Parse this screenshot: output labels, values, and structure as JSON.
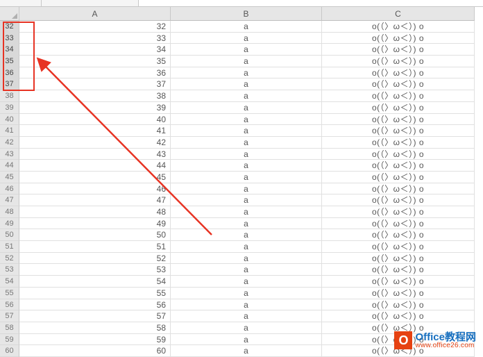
{
  "columns": {
    "A": "A",
    "B": "B",
    "C": "C"
  },
  "kaomoji": "o(（〉ω＜）) o",
  "selected_rows": [
    32,
    33,
    34,
    35,
    36,
    37
  ],
  "rows": [
    {
      "n": 32,
      "a": "32",
      "b": "a"
    },
    {
      "n": 33,
      "a": "33",
      "b": "a"
    },
    {
      "n": 34,
      "a": "34",
      "b": "a"
    },
    {
      "n": 35,
      "a": "35",
      "b": "a"
    },
    {
      "n": 36,
      "a": "36",
      "b": "a"
    },
    {
      "n": 37,
      "a": "37",
      "b": "a"
    },
    {
      "n": 38,
      "a": "38",
      "b": "a"
    },
    {
      "n": 39,
      "a": "39",
      "b": "a"
    },
    {
      "n": 40,
      "a": "40",
      "b": "a"
    },
    {
      "n": 41,
      "a": "41",
      "b": "a"
    },
    {
      "n": 42,
      "a": "42",
      "b": "a"
    },
    {
      "n": 43,
      "a": "43",
      "b": "a"
    },
    {
      "n": 44,
      "a": "44",
      "b": "a"
    },
    {
      "n": 45,
      "a": "45",
      "b": "a"
    },
    {
      "n": 46,
      "a": "46",
      "b": "a"
    },
    {
      "n": 47,
      "a": "47",
      "b": "a"
    },
    {
      "n": 48,
      "a": "48",
      "b": "a"
    },
    {
      "n": 49,
      "a": "49",
      "b": "a"
    },
    {
      "n": 50,
      "a": "50",
      "b": "a"
    },
    {
      "n": 51,
      "a": "51",
      "b": "a"
    },
    {
      "n": 52,
      "a": "52",
      "b": "a"
    },
    {
      "n": 53,
      "a": "53",
      "b": "a"
    },
    {
      "n": 54,
      "a": "54",
      "b": "a"
    },
    {
      "n": 55,
      "a": "55",
      "b": "a"
    },
    {
      "n": 56,
      "a": "56",
      "b": "a"
    },
    {
      "n": 57,
      "a": "57",
      "b": "a"
    },
    {
      "n": 58,
      "a": "58",
      "b": "a"
    },
    {
      "n": 59,
      "a": "59",
      "b": "a"
    },
    {
      "n": 60,
      "a": "60",
      "b": "a"
    }
  ],
  "watermark": {
    "icon_letter": "O",
    "title": "Office教程网",
    "url": "www.office26.com"
  },
  "annotation": {
    "color": "#e73323"
  }
}
